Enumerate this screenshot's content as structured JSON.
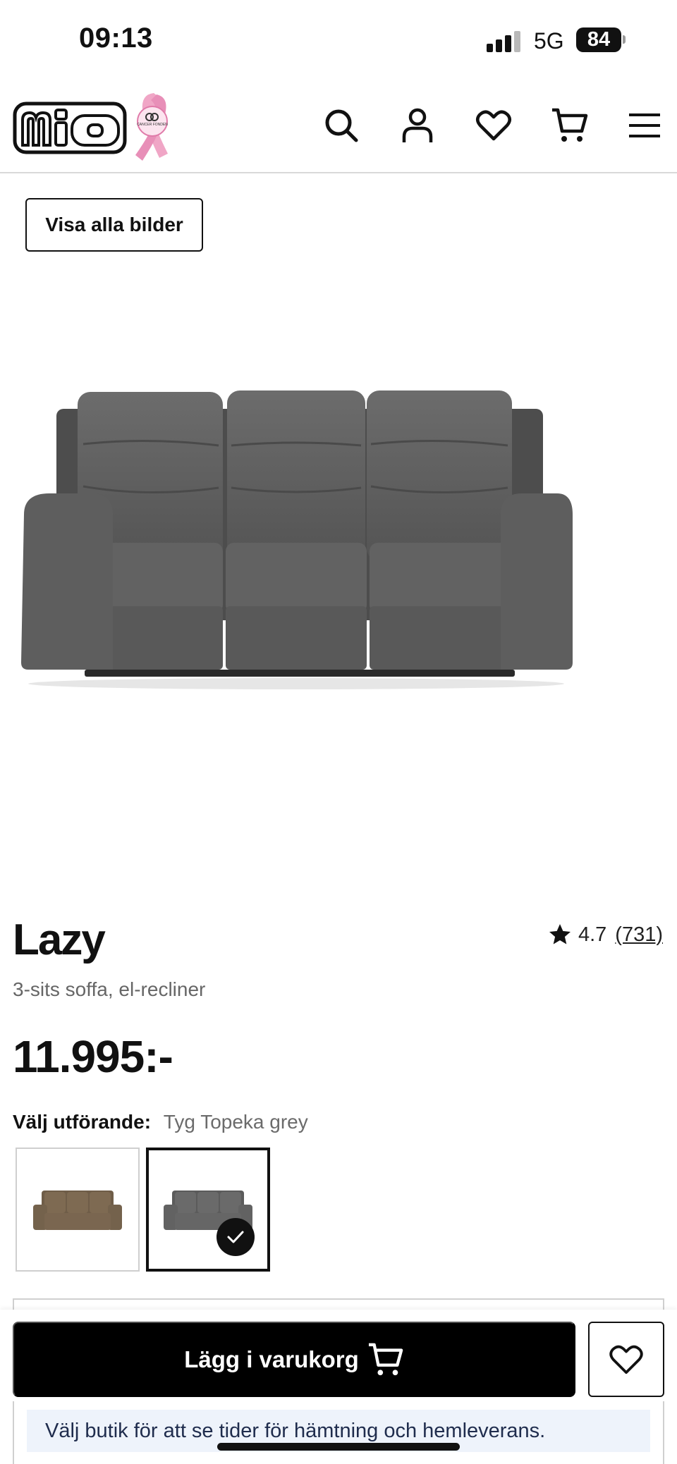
{
  "status_bar": {
    "time": "09:13",
    "network": "5G",
    "battery": "84"
  },
  "header": {
    "logo_text": "mio",
    "ribbon_text": "CANCER FONDEN",
    "icons": [
      "search-icon",
      "account-icon",
      "heart-icon",
      "cart-icon",
      "menu-icon"
    ]
  },
  "gallery": {
    "view_all_label": "Visa alla bilder"
  },
  "product": {
    "title": "Lazy",
    "subtitle": "3-sits soffa, el-recliner",
    "price": "11.995:-",
    "rating": "4.7",
    "review_count": "(731)"
  },
  "variant": {
    "label": "Välj utförande:",
    "value": "Tyg Topeka grey",
    "options": [
      {
        "color": "#7a6650",
        "selected": false
      },
      {
        "color": "#6a6a6a",
        "selected": true
      }
    ]
  },
  "actions": {
    "add_to_cart_label": "Lägg i varukorg",
    "store_notice": "Välj butik för att se tider för hämtning och hemleverans."
  },
  "colors": {
    "sofa": "#5f5f5f",
    "ribbon": "#f2a9c8",
    "notice_bg": "#eef3fb"
  }
}
